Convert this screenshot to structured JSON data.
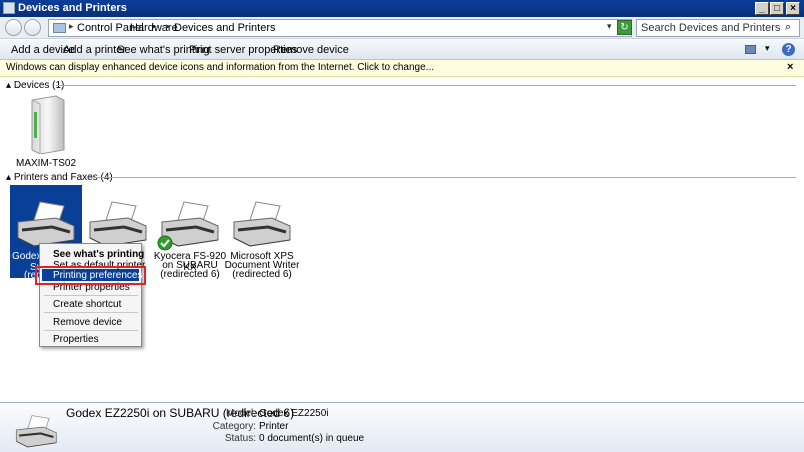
{
  "window": {
    "title": "Devices and Printers"
  },
  "address": {
    "crumbs": [
      "Control Panel",
      "Hardware",
      "Devices and Printers"
    ],
    "separator": "▸",
    "dropdown": "▾"
  },
  "search": {
    "placeholder": "Search Devices and Printers"
  },
  "commands": [
    "Add a device",
    "Add a printer",
    "See what's printing",
    "Print server properties",
    "Remove device"
  ],
  "infobar": {
    "text": "Windows can display enhanced device icons and information from the Internet. Click to change...",
    "close": "×"
  },
  "devices_group": {
    "label": "Devices (1)"
  },
  "devices": [
    {
      "name": "MAXIM-TS02"
    }
  ],
  "printers_group": {
    "label": "Printers and Faxes (4)"
  },
  "printers": [
    {
      "line1": "Godex",
      "line2": "Su",
      "line3": "(redi"
    },
    {
      "line1": "",
      "line2": "",
      "line3": ""
    },
    {
      "line1": "Kyocera FS-920 KX",
      "line2": "on SUBARU",
      "line3": "(redirected 6)"
    },
    {
      "line1": "Microsoft XPS",
      "line2": "Document Writer",
      "line3": "(redirected 6)"
    }
  ],
  "context_menu": {
    "items": [
      "See what's printing",
      "Set as default printer",
      "Printing preferences",
      "Printer properties",
      "Create shortcut",
      "Remove device",
      "Properties"
    ]
  },
  "details": {
    "title": "Godex EZ2250i on SUBARU (redirected 6)",
    "model_label": "Model:",
    "model_value": "Godex EZ2250i",
    "category_label": "Category:",
    "category_value": "Printer",
    "status_label": "Status:",
    "status_value": "0 document(s) in queue"
  },
  "colors": {
    "selection": "#0a3f98",
    "highlight_border": "#e0222a",
    "titlebar": "#0a3e9a"
  }
}
